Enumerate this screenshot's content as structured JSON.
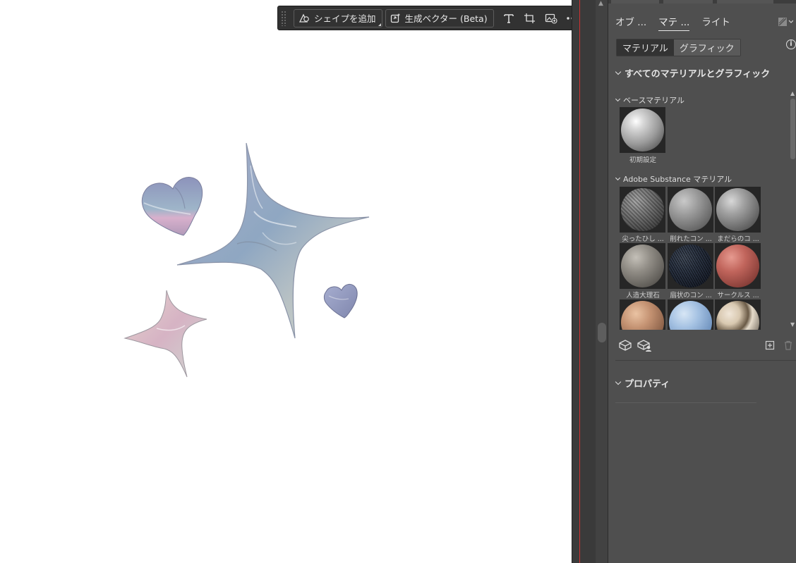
{
  "toolbar": {
    "add_shape_label": "シェイプを追加",
    "gen_vector_label": "生成ベクター (Beta)"
  },
  "panel": {
    "tabs": [
      {
        "label": "オブ ..."
      },
      {
        "label": "マテ ..."
      },
      {
        "label": "ライト"
      }
    ],
    "segment": {
      "material": "マテリアル",
      "graphic": "グラフィック"
    },
    "all_section": "すべてのマテリアルとグラフィック",
    "base_section": "ベースマテリアル",
    "base_items": [
      {
        "label": "初期設定"
      }
    ],
    "substance_section": "Adobe Substance マテリアル",
    "substance_items": [
      {
        "label": "尖ったひし ..."
      },
      {
        "label": "削れたコン ..."
      },
      {
        "label": "まだらのコ ..."
      },
      {
        "label": "人造大理石"
      },
      {
        "label": "扇状のコン ..."
      },
      {
        "label": "サークルス ..."
      },
      {
        "label": ""
      },
      {
        "label": ""
      },
      {
        "label": ""
      }
    ],
    "properties_section": "プロパティ"
  },
  "colors": {
    "panel_bg": "#4f4f4f",
    "toolbar_bg": "#323232",
    "guide_red": "#d03030"
  }
}
